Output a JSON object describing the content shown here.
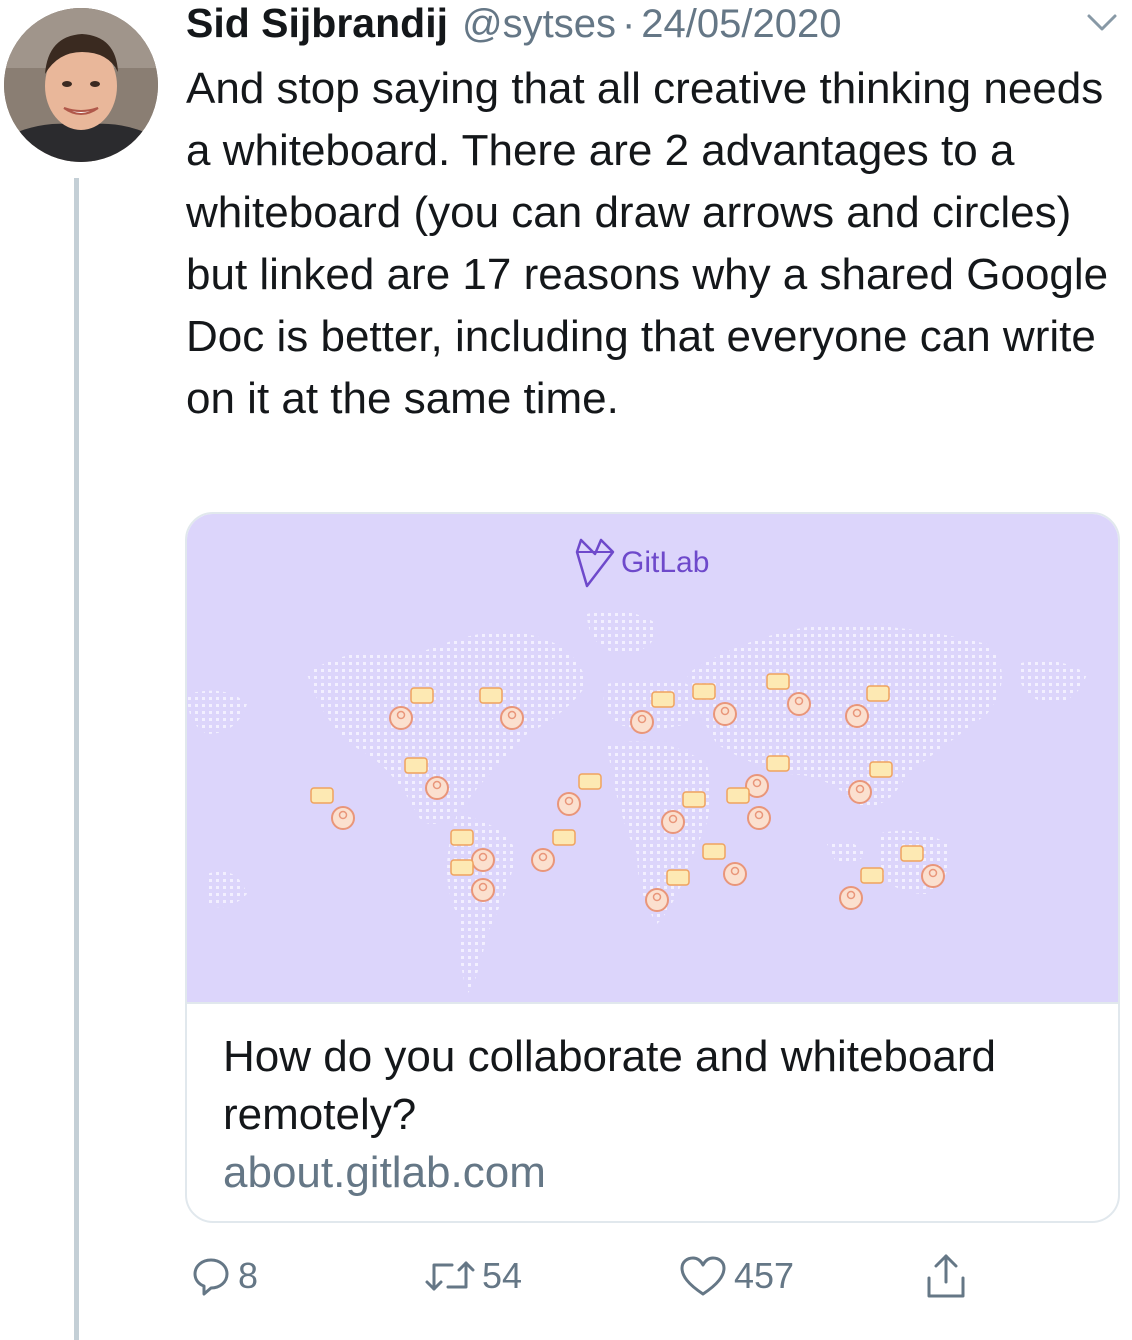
{
  "tweet": {
    "author_name": "Sid Sijbrandij",
    "author_handle": "@sytses",
    "separator": "·",
    "date": "24/05/2020",
    "text": "And stop saying that all creative thinking needs a whiteboard. There are 2 advantages to a whiteboard (you can draw arrows and circles) but linked are 17 reasons why a shared Google Doc is better, including that everyone can write on it at the same time."
  },
  "link_card": {
    "image_brand": "GitLab",
    "title": "How do you collaborate and whiteboard remotely?",
    "domain": "about.gitlab.com"
  },
  "actions": {
    "replies": "8",
    "retweets": "54",
    "likes": "457"
  },
  "colors": {
    "text": "#14171a",
    "secondary": "#657786",
    "card_image_bg": "#dcd5fb",
    "brand": "#6e49cb",
    "thread_line": "#c4cfd6"
  },
  "icons": {
    "more": "chevron-down-icon",
    "reply": "comment-icon",
    "retweet": "retweet-icon",
    "like": "heart-icon",
    "share": "share-icon"
  }
}
